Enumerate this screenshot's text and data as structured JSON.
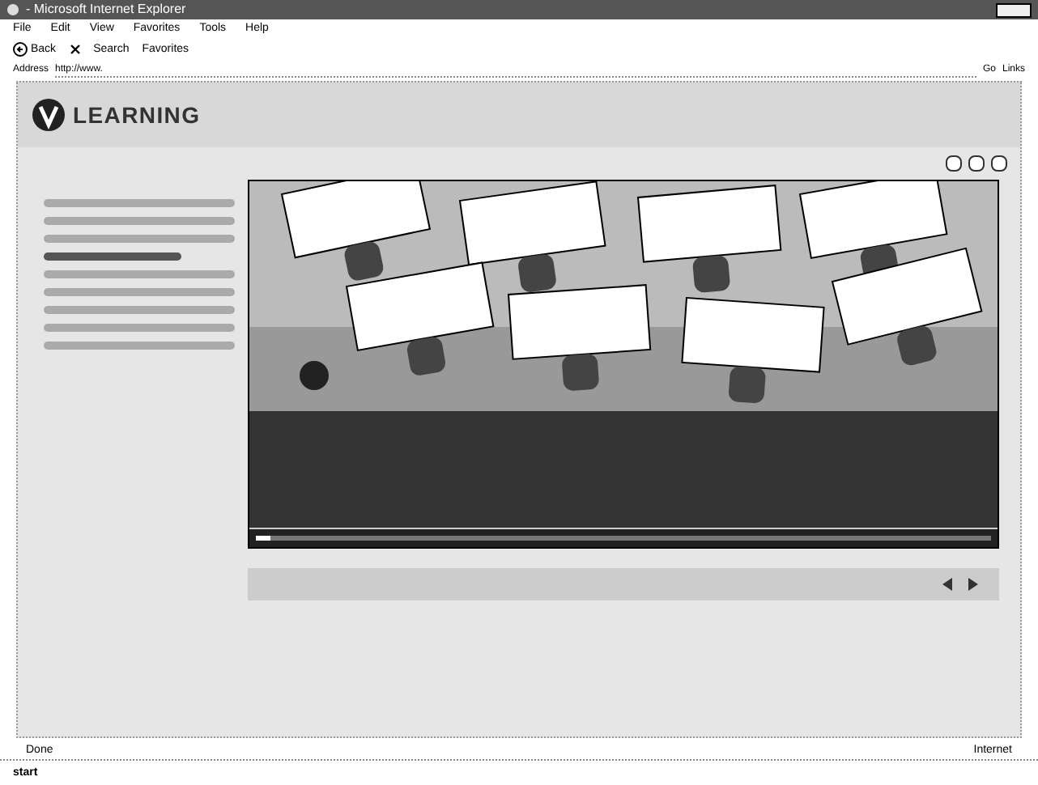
{
  "window": {
    "title": "- Microsoft Internet Explorer"
  },
  "menu": [
    "File",
    "Edit",
    "View",
    "Favorites",
    "Tools",
    "Help"
  ],
  "toolbar": {
    "back": "Back",
    "search": "Search",
    "favorites": "Favorites"
  },
  "address": {
    "label": "Address",
    "value": "http://www.",
    "go": "Go",
    "links": "Links"
  },
  "site": {
    "logo": "LEARNING",
    "sidebar_items": [
      {
        "selected": false
      },
      {
        "selected": false
      },
      {
        "selected": false
      },
      {
        "selected": true
      },
      {
        "selected": false
      },
      {
        "selected": false
      },
      {
        "selected": false
      },
      {
        "selected": false
      },
      {
        "selected": false
      }
    ],
    "player": {
      "level": 0.02
    }
  },
  "status_bar": {
    "text": "Done",
    "zone": "Internet"
  },
  "taskbar": {
    "start": "start"
  }
}
